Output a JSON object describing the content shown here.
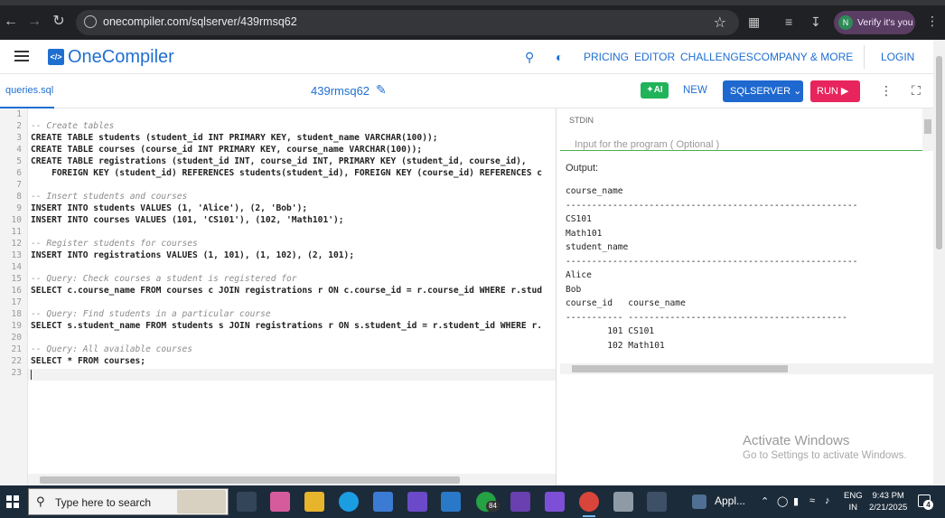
{
  "browser": {
    "url": "onecompiler.com/sqlserver/439rmsq62",
    "verify_label": "Verify it's you",
    "verify_avatar": "N",
    "icons": [
      "back-icon",
      "forward-icon",
      "reload-icon",
      "site-settings-icon",
      "bookmark-star-icon",
      "extensions-icon",
      "media-icon",
      "download-icon",
      "chrome-menu-icon"
    ]
  },
  "header": {
    "logo_mark": "</>",
    "logo_text": "OneCompiler",
    "nav": {
      "pricing": "PRICING",
      "editor": "EDITOR",
      "challenges": "CHALLENGES",
      "company": "COMPANY & MORE",
      "login": "LOGIN"
    }
  },
  "toolbar": {
    "file_tab": "queries.sql",
    "code_id": "439rmsq62",
    "ai_label": "AI",
    "new_label": "NEW",
    "language_label": "SQLSERVER",
    "run_label": "RUN"
  },
  "editor": {
    "line_numbers": [
      "1",
      "2",
      "3",
      "4",
      "5",
      "6",
      "7",
      "8",
      "9",
      "10",
      "11",
      "12",
      "13",
      "14",
      "15",
      "16",
      "17",
      "18",
      "19",
      "20",
      "21",
      "22",
      "23"
    ],
    "lines": [
      {
        "text": "",
        "kind": "code"
      },
      {
        "text": "-- Create tables",
        "kind": "comment"
      },
      {
        "text": "CREATE TABLE students (student_id INT PRIMARY KEY, student_name VARCHAR(100));",
        "kind": "code"
      },
      {
        "text": "CREATE TABLE courses (course_id INT PRIMARY KEY, course_name VARCHAR(100));",
        "kind": "code"
      },
      {
        "text": "CREATE TABLE registrations (student_id INT, course_id INT, PRIMARY KEY (student_id, course_id),",
        "kind": "code"
      },
      {
        "text": "    FOREIGN KEY (student_id) REFERENCES students(student_id), FOREIGN KEY (course_id) REFERENCES c",
        "kind": "code"
      },
      {
        "text": "",
        "kind": "code"
      },
      {
        "text": "-- Insert students and courses",
        "kind": "comment"
      },
      {
        "text": "INSERT INTO students VALUES (1, 'Alice'), (2, 'Bob');",
        "kind": "code"
      },
      {
        "text": "INSERT INTO courses VALUES (101, 'CS101'), (102, 'Math101');",
        "kind": "code"
      },
      {
        "text": "",
        "kind": "code"
      },
      {
        "text": "-- Register students for courses",
        "kind": "comment"
      },
      {
        "text": "INSERT INTO registrations VALUES (1, 101), (1, 102), (2, 101);",
        "kind": "code"
      },
      {
        "text": "",
        "kind": "code"
      },
      {
        "text": "-- Query: Check courses a student is registered for",
        "kind": "comment"
      },
      {
        "text": "SELECT c.course_name FROM courses c JOIN registrations r ON c.course_id = r.course_id WHERE r.stud",
        "kind": "code"
      },
      {
        "text": "",
        "kind": "code"
      },
      {
        "text": "-- Query: Find students in a particular course",
        "kind": "comment"
      },
      {
        "text": "SELECT s.student_name FROM students s JOIN registrations r ON s.student_id = r.student_id WHERE r.",
        "kind": "code"
      },
      {
        "text": "",
        "kind": "code"
      },
      {
        "text": "-- Query: All available courses",
        "kind": "comment"
      },
      {
        "text": "SELECT * FROM courses;",
        "kind": "code"
      },
      {
        "text": "",
        "kind": "code"
      }
    ]
  },
  "stdin": {
    "label": "STDIN",
    "placeholder": "Input for the program ( Optional )"
  },
  "output": {
    "label": "Output:",
    "lines": [
      "course_name",
      "--------------------------------------------------------",
      "CS101",
      "Math101",
      "student_name",
      "--------------------------------------------------------",
      "Alice",
      "Bob",
      "course_id   course_name",
      "----------- ------------------------------------------",
      "        101 CS101",
      "        102 Math101"
    ]
  },
  "watermark": {
    "title": "Activate Windows",
    "subtitle": "Go to Settings to activate Windows."
  },
  "taskbar": {
    "search_placeholder": "Type here to search",
    "whatsapp_badge": "84",
    "active_app_label": "Appl...",
    "lang_line1": "ENG",
    "lang_line2": "IN",
    "time": "9:43 PM",
    "date": "2/21/2025",
    "notification_count": "4"
  }
}
